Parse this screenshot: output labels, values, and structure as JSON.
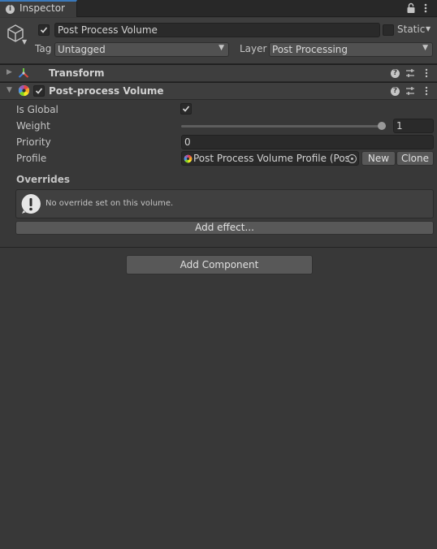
{
  "tab": {
    "label": "Inspector",
    "info_icon": "info-icon",
    "lock_icon": "lock-icon",
    "menu_icon": "kebab-menu-icon"
  },
  "object": {
    "name": "Post Process Volume",
    "active": true,
    "static_label": "Static",
    "static": false,
    "tag_label": "Tag",
    "tag_value": "Untagged",
    "layer_label": "Layer",
    "layer_value": "Post Processing"
  },
  "components": {
    "transform": {
      "title": "Transform",
      "expanded": false
    },
    "post_process_volume": {
      "title": "Post-process Volume",
      "expanded": true,
      "enabled": true,
      "properties": {
        "is_global_label": "Is Global",
        "is_global": true,
        "weight_label": "Weight",
        "weight_value": "1",
        "weight_fraction": 1.0,
        "priority_label": "Priority",
        "priority_value": "0",
        "profile_label": "Profile",
        "profile_value": "Post Process Volume Profile (Post",
        "new_label": "New",
        "clone_label": "Clone"
      },
      "overrides_label": "Overrides",
      "overrides_message": "No override set on this volume.",
      "add_effect_label": "Add effect..."
    }
  },
  "add_component_label": "Add Component",
  "colors": {
    "accent": "#3a79bb",
    "panel": "#383838",
    "header": "#3e3e3e",
    "field": "#2a2a2a",
    "button": "#585858"
  }
}
